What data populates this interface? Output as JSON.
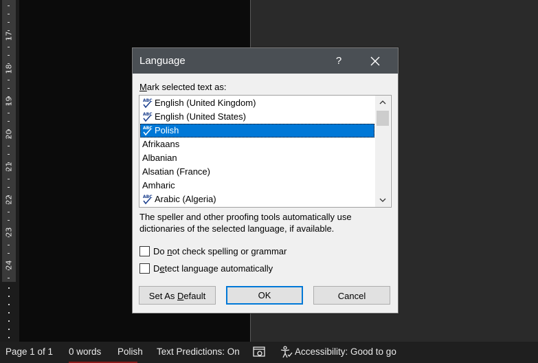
{
  "ruler": {
    "numbers": [
      "17",
      "18",
      "19",
      "20",
      "21",
      "22",
      "23",
      "24"
    ]
  },
  "dialog": {
    "title": "Language",
    "help_label": "?",
    "mark_label_prefix": "M",
    "mark_label_rest": "ark selected text as:",
    "languages": [
      {
        "name": "English (United Kingdom)",
        "spellcheck": true,
        "selected": false
      },
      {
        "name": "English (United States)",
        "spellcheck": true,
        "selected": false
      },
      {
        "name": "Polish",
        "spellcheck": true,
        "selected": true
      },
      {
        "name": "Afrikaans",
        "spellcheck": false,
        "selected": false
      },
      {
        "name": "Albanian",
        "spellcheck": false,
        "selected": false
      },
      {
        "name": "Alsatian (France)",
        "spellcheck": false,
        "selected": false
      },
      {
        "name": "Amharic",
        "spellcheck": false,
        "selected": false
      },
      {
        "name": "Arabic (Algeria)",
        "spellcheck": true,
        "selected": false
      }
    ],
    "description_line1": "The speller and other proofing tools automatically use",
    "description_line2": "dictionaries of the selected language, if available.",
    "no_check_prefix": "Do ",
    "no_check_underlined": "n",
    "no_check_rest": "ot check spelling or grammar",
    "no_check_checked": false,
    "detect_prefix": "D",
    "detect_underlined": "e",
    "detect_rest": "tect language automatically",
    "detect_checked": false,
    "set_default_prefix": "Set As ",
    "set_default_underlined": "D",
    "set_default_rest": "efault",
    "ok_label": "OK",
    "cancel_label": "Cancel"
  },
  "statusbar": {
    "page": "Page 1 of 1",
    "words": "0 words",
    "language": "Polish",
    "text_predictions": "Text Predictions: On",
    "accessibility": "Accessibility: Good to go"
  },
  "colors": {
    "selection": "#0078d7",
    "titlebar": "#4a4f54",
    "spell_icon": "#1a3e8c"
  }
}
